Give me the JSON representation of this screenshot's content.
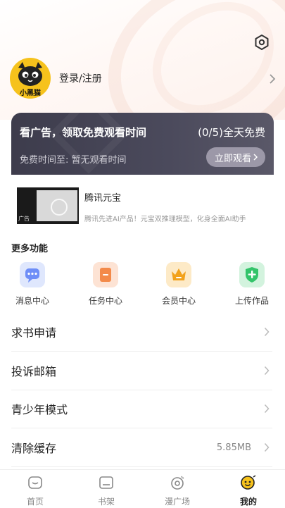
{
  "profile": {
    "avatar_caption": "小黑猫",
    "login_text": "登录/注册"
  },
  "ad_banner": {
    "title": "看广告，领取免费观看时间",
    "count_text": "(0/5)全天免费",
    "subtitle": "免费时间至: 暂无观看时间",
    "button_label": "立即观看"
  },
  "promo": {
    "title": "腾讯元宝",
    "description": "腾讯先进AI产品！元宝双推理模型，化身全面AI助手",
    "tag": "广告"
  },
  "more_features": {
    "title": "更多功能",
    "items": [
      {
        "label": "消息中心",
        "icon": "message-icon",
        "color": "#6e8ef7"
      },
      {
        "label": "任务中心",
        "icon": "task-icon",
        "color": "#f38a4a"
      },
      {
        "label": "会员中心",
        "icon": "crown-icon",
        "color": "#f2a21c"
      },
      {
        "label": "上传作品",
        "icon": "upload-icon",
        "color": "#33c46a"
      }
    ]
  },
  "menu": [
    {
      "label": "求书申请",
      "value": ""
    },
    {
      "label": "投诉邮箱",
      "value": ""
    },
    {
      "label": "青少年模式",
      "value": ""
    },
    {
      "label": "清除缓存",
      "value": "5.85MB"
    }
  ],
  "tabbar": [
    {
      "label": "首页",
      "icon": "home-icon",
      "active": false
    },
    {
      "label": "书架",
      "icon": "bookshelf-icon",
      "active": false
    },
    {
      "label": "漫广场",
      "icon": "plaza-icon",
      "active": false
    },
    {
      "label": "我的",
      "icon": "mine-icon",
      "active": true
    }
  ],
  "colors": {
    "banner_bg": "#44434f",
    "banner_button": "#9c98a8",
    "avatar_bg": "#f6c21c",
    "active_tab": "#f6c21c"
  }
}
